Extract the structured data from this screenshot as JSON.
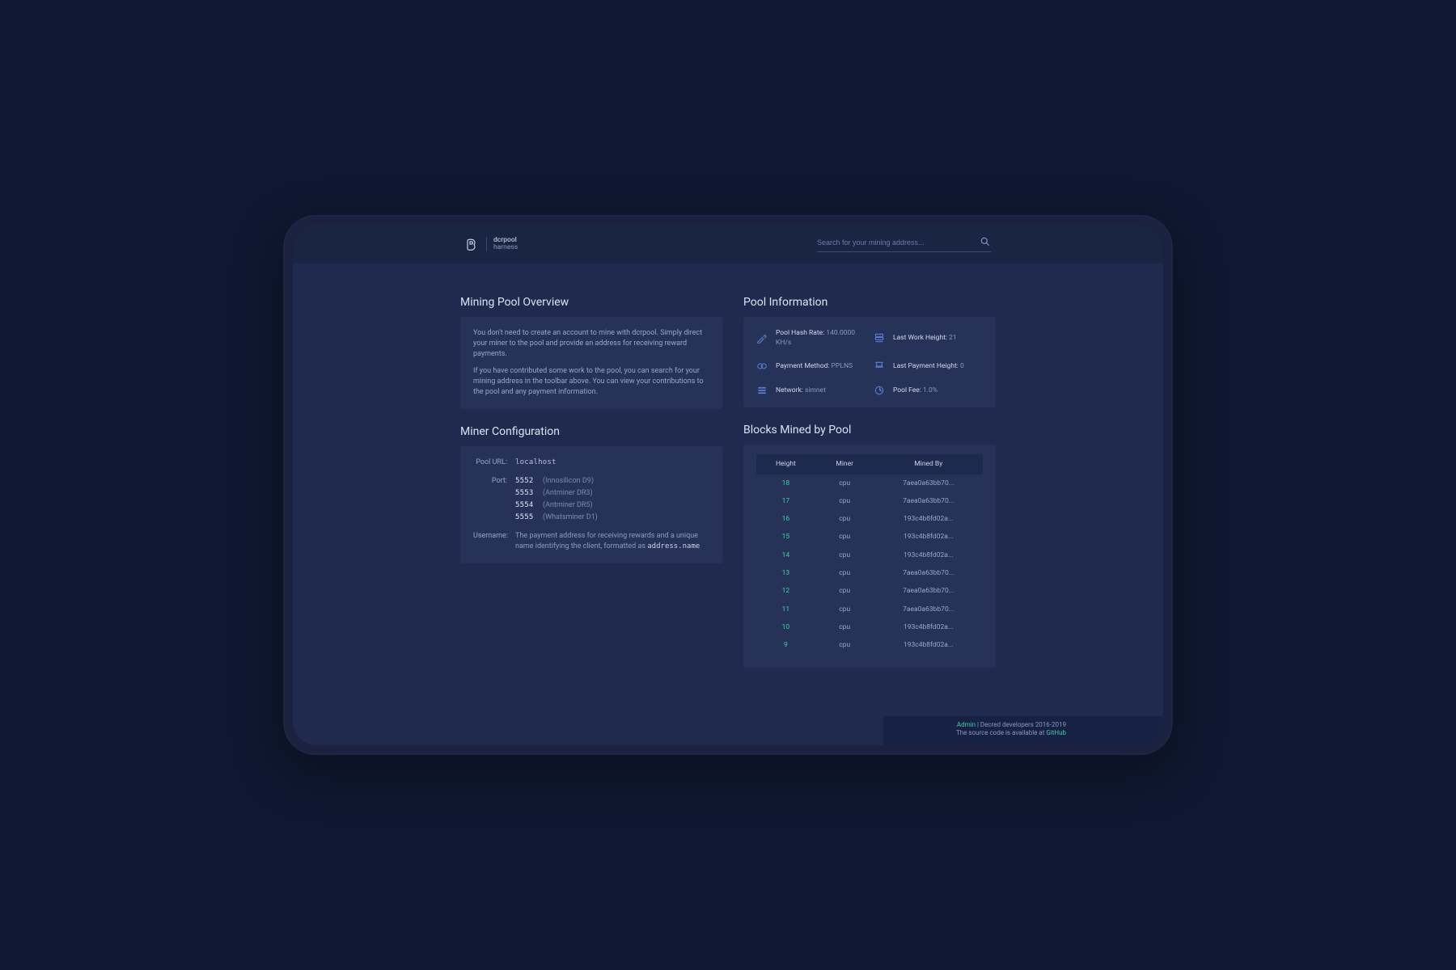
{
  "header": {
    "logo_line1": "dcrpool",
    "logo_line2": "harness",
    "search_placeholder": "Search for your mining address..."
  },
  "overview": {
    "title": "Mining Pool Overview",
    "p1": "You don't need to create an account to mine with dcrpool. Simply direct your miner to the pool and provide an address for receiving reward payments.",
    "p2": "If you have contributed some work to the pool, you can search for your mining address in the toolbar above. You can view your contributions to the pool and any payment information."
  },
  "pool_info": {
    "title": "Pool Information",
    "items": [
      {
        "label": "Pool Hash Rate:",
        "value": "140.0000 KH/s"
      },
      {
        "label": "Last Work Height:",
        "value": "21"
      },
      {
        "label": "Payment Method:",
        "value": "PPLNS"
      },
      {
        "label": "Last Payment Height:",
        "value": "0"
      },
      {
        "label": "Network:",
        "value": "simnet"
      },
      {
        "label": "Pool Fee:",
        "value": "1.0%"
      }
    ]
  },
  "miner_config": {
    "title": "Miner Configuration",
    "pool_url_label": "Pool URL:",
    "pool_url_value": "localhost",
    "port_label": "Port:",
    "ports": [
      {
        "num": "5552",
        "name": "(Innosilicon D9)"
      },
      {
        "num": "5553",
        "name": "(Antminer DR3)"
      },
      {
        "num": "5554",
        "name": "(Antminer DR5)"
      },
      {
        "num": "5555",
        "name": "(Whatsminer D1)"
      }
    ],
    "username_label": "Username:",
    "username_desc": "The payment address for receiving rewards and a unique name identifying the client, formatted as ",
    "username_format": "address.name"
  },
  "blocks": {
    "title": "Blocks Mined by Pool",
    "columns": {
      "height": "Height",
      "miner": "Miner",
      "mined_by": "Mined By"
    },
    "rows": [
      {
        "height": "18",
        "miner": "cpu",
        "mined_by": "7aea0a63bb70..."
      },
      {
        "height": "17",
        "miner": "cpu",
        "mined_by": "7aea0a63bb70..."
      },
      {
        "height": "16",
        "miner": "cpu",
        "mined_by": "193c4b8fd02a..."
      },
      {
        "height": "15",
        "miner": "cpu",
        "mined_by": "193c4b8fd02a..."
      },
      {
        "height": "14",
        "miner": "cpu",
        "mined_by": "193c4b8fd02a..."
      },
      {
        "height": "13",
        "miner": "cpu",
        "mined_by": "7aea0a63bb70..."
      },
      {
        "height": "12",
        "miner": "cpu",
        "mined_by": "7aea0a63bb70..."
      },
      {
        "height": "11",
        "miner": "cpu",
        "mined_by": "7aea0a63bb70..."
      },
      {
        "height": "10",
        "miner": "cpu",
        "mined_by": "193c4b8fd02a..."
      },
      {
        "height": "9",
        "miner": "cpu",
        "mined_by": "193c4b8fd02a..."
      }
    ]
  },
  "footer": {
    "admin": "Admin",
    "sep": " | ",
    "copyright": "Decred developers 2016-2019",
    "source_prefix": "The source code is available at ",
    "source_link": "GitHub"
  },
  "colors": {
    "accent": "#3fcfa4",
    "icon": "#5a7fd6"
  }
}
